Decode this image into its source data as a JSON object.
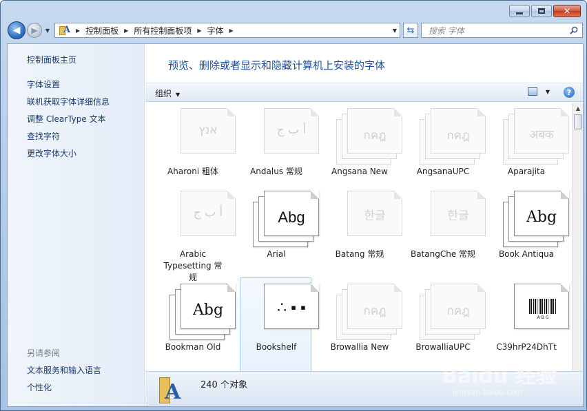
{
  "window": {
    "caption": {
      "minimize": "",
      "maximize": "",
      "close": "✕"
    }
  },
  "nav": {
    "back_glyph": "◀",
    "fwd_glyph": "▶",
    "breadcrumbs": [
      "控制面板",
      "所有控制面板项",
      "字体"
    ],
    "search_placeholder": "搜索 字体"
  },
  "left_pane": {
    "home": "控制面板主页",
    "links": [
      "字体设置",
      "联机获取字体详细信息",
      "调整 ClearType 文本",
      "查找字符",
      "更改字体大小"
    ],
    "see_also_title": "另请参阅",
    "see_also": [
      "文本服务和输入语言",
      "个性化"
    ]
  },
  "header": {
    "title": "预览、删除或者显示和隐藏计算机上安装的字体",
    "organize": "组织",
    "help": "?"
  },
  "fonts": [
    {
      "name": "Aharoni 粗体",
      "sample": "אנץ",
      "style": "faded-single"
    },
    {
      "name": "Andalus 常规",
      "sample": "أ ب ج",
      "style": "faded-single"
    },
    {
      "name": "Angsana New",
      "sample": "กคฎ",
      "style": "faded-stack"
    },
    {
      "name": "AngsanaUPC",
      "sample": "กคฎ",
      "style": "faded-stack"
    },
    {
      "name": "Aparajita",
      "sample": "अबक",
      "style": "faded-stack"
    },
    {
      "name": "Arabic Typesetting 常规",
      "sample": "أ ب ج",
      "style": "faded-single"
    },
    {
      "name": "Arial",
      "sample": "Abg",
      "style": "strong-stack"
    },
    {
      "name": "Batang 常规",
      "sample": "한글",
      "style": "faded-single"
    },
    {
      "name": "BatangChe 常规",
      "sample": "한글",
      "style": "faded-single"
    },
    {
      "name": "Book Antiqua",
      "sample": "Abg",
      "style": "strong-stack-serif"
    },
    {
      "name": "Bookman Old",
      "sample": "Abg",
      "style": "strong-stack-serif"
    },
    {
      "name": "Bookshelf",
      "sample": "∴ ▪ ▪",
      "style": "strong-single"
    },
    {
      "name": "Browallia New",
      "sample": "กคฎ",
      "style": "faded-stack"
    },
    {
      "name": "BrowalliaUPC",
      "sample": "กคฎ",
      "style": "faded-stack"
    },
    {
      "name": "C39hrP24DhTt",
      "sample": "A B G",
      "style": "barcode"
    }
  ],
  "details": {
    "count": "240 个对象"
  },
  "watermark": {
    "brand": "Baidu 经验",
    "url": "jingyan.baidu.com"
  }
}
